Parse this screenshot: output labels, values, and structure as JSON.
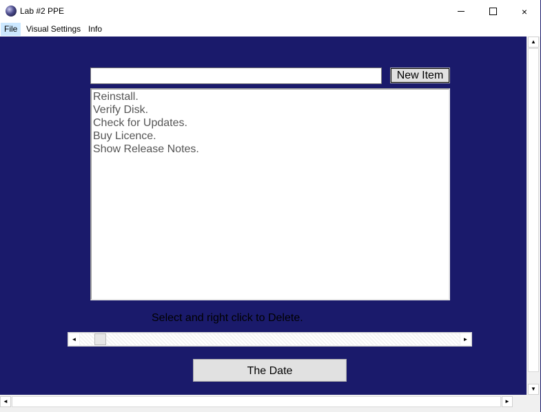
{
  "window": {
    "title": "Lab #2 PPE",
    "icon": "app-sphere-icon",
    "controls": {
      "minimize": "minimize-icon",
      "maximize": "maximize-icon",
      "close": "×"
    }
  },
  "menu": {
    "items": [
      {
        "label": "File",
        "active": true
      },
      {
        "label": "Visual Settings"
      },
      {
        "label": "Info"
      }
    ]
  },
  "form": {
    "item_input": {
      "value": "",
      "placeholder": ""
    },
    "new_item_label": "New Item",
    "list_items": [
      "Reinstall.",
      "Verify Disk.",
      "Check for Updates.",
      "Buy Licence.",
      "Show Release Notes."
    ],
    "hint": "Select and right click to Delete.",
    "slider": {
      "left_arrow": "◄",
      "right_arrow": "►",
      "position": 0.04
    },
    "date_button_label": "The Date"
  },
  "scrollbars": {
    "up": "▲",
    "down": "▼",
    "left": "◄",
    "right": "►"
  },
  "colors": {
    "client_background": "#1a1a6b",
    "button_face": "#e1e1e1"
  }
}
